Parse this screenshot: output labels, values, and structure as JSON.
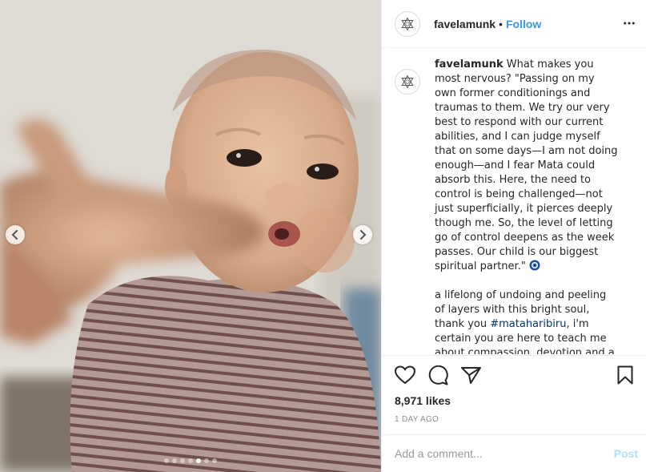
{
  "post": {
    "username": "favelamunk",
    "separator": "•",
    "follow_label": "Follow",
    "more_icon": "more-horizontal-icon",
    "avatar_icon": "star-of-david-icon"
  },
  "caption": {
    "username": "favelamunk",
    "paragraph1": "What makes you most nervous? \"Passing on my own former conditionings and traumas to them. We try our very best to respond with our current abilities, and I can judge myself that on some days—I am not doing enough—and I fear Mata could absorb this. Here, the need to control is being challenged—not just superficially, it pierces deeply though me. So, the level of letting go of control deepens as the week passes. Our child is our biggest spiritual partner.\"",
    "emoji_icon": "nazar-eye-icon",
    "paragraph2_before": "a lifelong of undoing and peeling of layers with this bright soul, thank you ",
    "hashtag": "#mataharibiru",
    "paragraph2_after": ", i'm certain you are here to teach me about compassion, devotion and a whole lot of patience."
  },
  "actions": {
    "like_icon": "heart-icon",
    "comment_icon": "comment-bubble-icon",
    "share_icon": "paper-plane-icon",
    "save_icon": "bookmark-icon",
    "likes": "8,971 likes",
    "timestamp": "1 DAY AGO"
  },
  "comment_box": {
    "placeholder": "Add a comment...",
    "post_label": "Post"
  },
  "carousel": {
    "prev_icon": "chevron-left-icon",
    "next_icon": "chevron-right-icon",
    "slide_count": 7,
    "active_index": 4
  },
  "colors": {
    "link_blue": "#3897f0",
    "hashtag": "#003569",
    "post_disabled": "#b2dffc",
    "muted": "#8e8e8e"
  }
}
